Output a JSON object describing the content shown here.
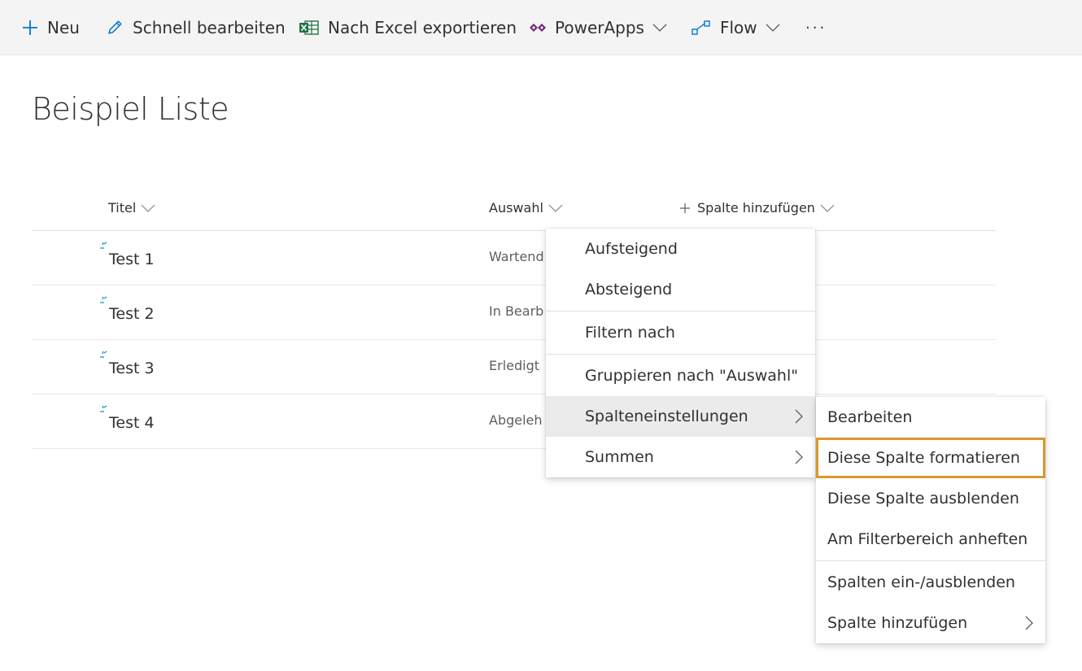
{
  "toolbar": {
    "new_label": "Neu",
    "quick_edit_label": "Schnell bearbeiten",
    "export_label": "Nach Excel exportieren",
    "powerapps_label": "PowerApps",
    "flow_label": "Flow",
    "more_label": "···"
  },
  "page": {
    "title": "Beispiel Liste"
  },
  "columns": {
    "title": "Titel",
    "choice": "Auswahl",
    "add": "Spalte hinzufügen"
  },
  "rows": [
    {
      "title": "Test 1",
      "choice": "Wartend"
    },
    {
      "title": "Test 2",
      "choice": "In Bearb"
    },
    {
      "title": "Test 3",
      "choice": "Erledigt"
    },
    {
      "title": "Test 4",
      "choice": "Abgeleh"
    }
  ],
  "column_menu": {
    "items": [
      "Aufsteigend",
      "Absteigend",
      "Filtern nach",
      "Gruppieren nach \"Auswahl\"",
      "Spalteneinstellungen",
      "Summen"
    ]
  },
  "settings_submenu": {
    "items": [
      "Bearbeiten",
      "Diese Spalte formatieren",
      "Diese Spalte ausblenden",
      "Am Filterbereich anheften",
      "Spalten ein-/ausblenden",
      "Spalte hinzufügen"
    ]
  },
  "colors": {
    "accent": "#0078d4",
    "highlight": "#d79a2b",
    "excel": "#217346",
    "new_marker": "#009ca6"
  }
}
